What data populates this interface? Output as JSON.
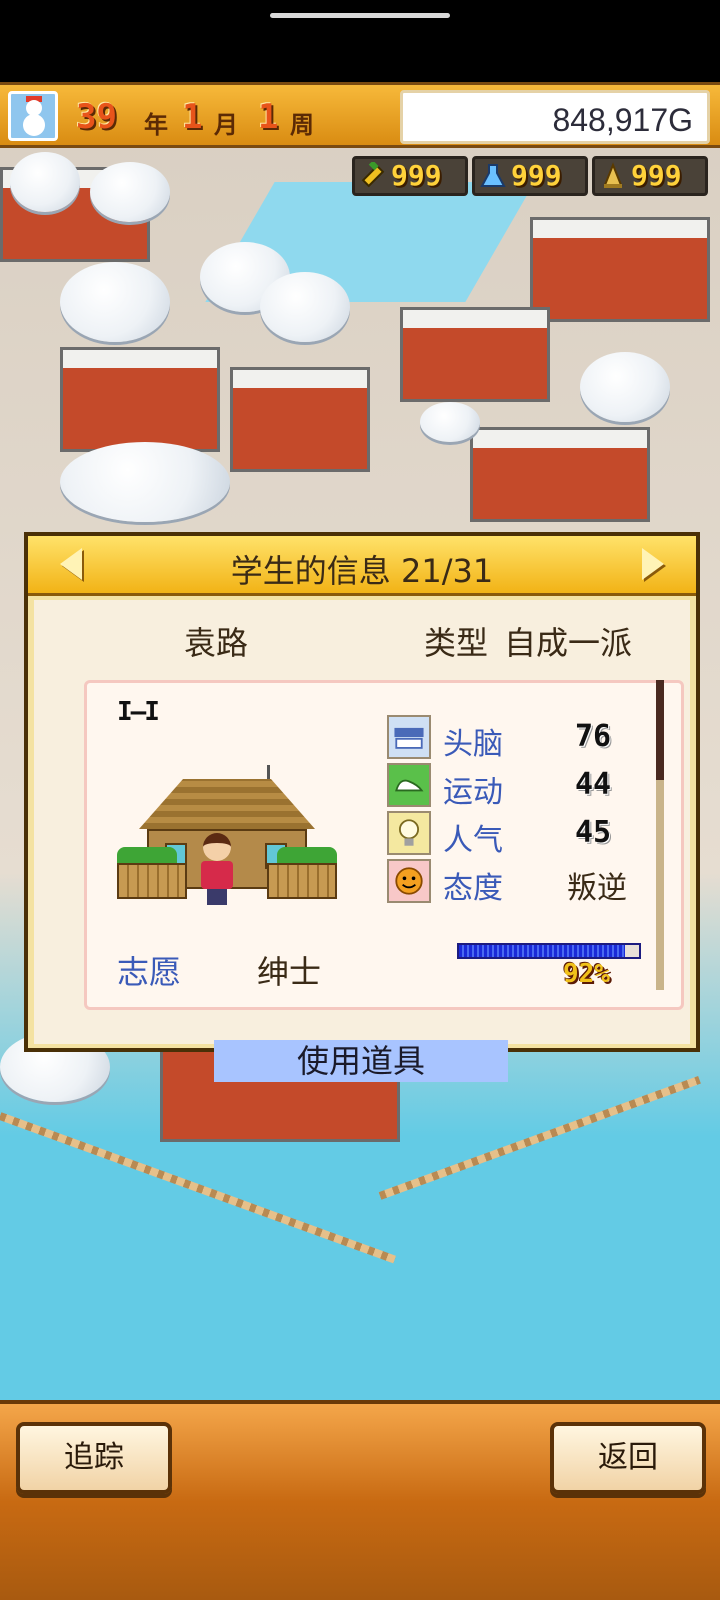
{
  "hud": {
    "year": "39",
    "year_unit": "年",
    "month": "1",
    "month_unit": "月",
    "week": "1",
    "week_unit": "周",
    "money": "848,917G"
  },
  "resources": [
    {
      "icon": "pencil-icon",
      "value": "999"
    },
    {
      "icon": "flask-icon",
      "value": "999"
    },
    {
      "icon": "bell-icon",
      "value": "999"
    }
  ],
  "dialog": {
    "title": "学生的信息 21/31",
    "student_name": "袁路",
    "type_label": "类型",
    "type_value": "自成一派",
    "badge": "I—I",
    "stats": [
      {
        "icon": "brain-icon",
        "label": "头脑",
        "value": "76"
      },
      {
        "icon": "sneaker-icon",
        "label": "运动",
        "value": "44"
      },
      {
        "icon": "lightbulb-icon",
        "label": "人气",
        "value": "45"
      },
      {
        "icon": "face-icon",
        "label": "态度",
        "value": "叛逆"
      }
    ],
    "wish_label": "志愿",
    "wish_value": "绅士",
    "progress_text": "92%",
    "progress_value": 92,
    "use_item_label": "使用道具"
  },
  "bottom": {
    "track_label": "追踪",
    "back_label": "返回"
  },
  "colors": {
    "accent_orange": "#f2b316",
    "stat_blue": "#3a5ab8",
    "button_blue": "#a8c4ff"
  }
}
